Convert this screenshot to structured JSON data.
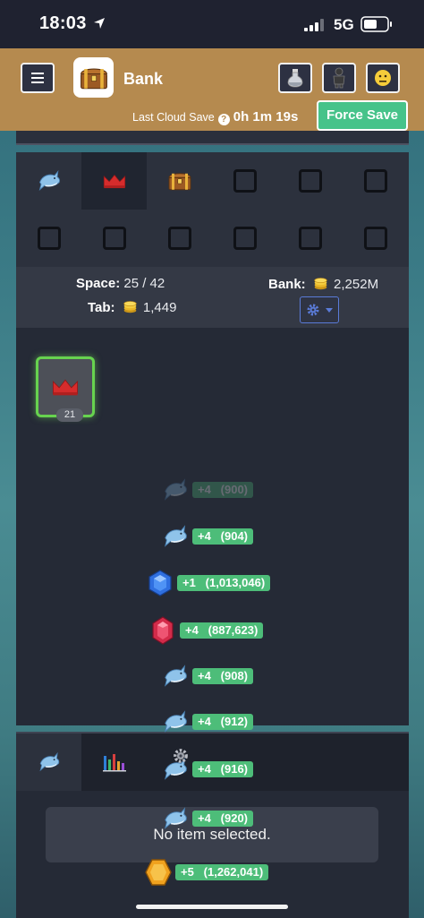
{
  "status_bar": {
    "time": "18:03",
    "network": "5G"
  },
  "header": {
    "title": "Bank",
    "cloud_save_label": "Last Cloud Save",
    "cloud_save_time": "0h 1m 19s",
    "force_save_label": "Force Save"
  },
  "bank": {
    "space_label": "Space:",
    "space_value": "25 / 42",
    "tab_label": "Tab:",
    "tab_value": "1,449",
    "bank_label": "Bank:",
    "bank_value": "2,252M",
    "selected_item_qty": "21"
  },
  "tabs": [
    {
      "icon": "shark-icon"
    },
    {
      "icon": "crown-icon",
      "active": true
    },
    {
      "icon": "treasure-chest-icon"
    },
    {
      "icon": "empty-slot-icon"
    }
  ],
  "bottom_panel": {
    "tabs": [
      {
        "icon": "shark-icon"
      },
      {
        "icon": "bar-chart-icon"
      }
    ],
    "no_item_text": "No item selected."
  },
  "notifications": [
    {
      "icon": "shark-icon",
      "text": "+4   (900)",
      "faded": true
    },
    {
      "icon": "shark-icon",
      "text": "+4   (904)"
    },
    {
      "icon": "sapphire-icon",
      "text": "+1   (1,013,046)"
    },
    {
      "icon": "ruby-icon",
      "text": "+4   (887,623)"
    },
    {
      "icon": "shark-icon",
      "text": "+4   (908)"
    },
    {
      "icon": "shark-icon",
      "text": "+4   (912)"
    },
    {
      "icon": "shark-icon",
      "text": "+4   (916)"
    },
    {
      "icon": "shark-icon",
      "text": "+4   (920)"
    },
    {
      "icon": "gp-coins-icon",
      "text": "+5   (1,262,041)"
    }
  ],
  "colors": {
    "header_bg": "#b58a4f",
    "force_save_bg": "#46c38a",
    "notification_pill": "#4dbd79",
    "panel_bg": "#252a36",
    "selected_border": "#67d34f"
  }
}
